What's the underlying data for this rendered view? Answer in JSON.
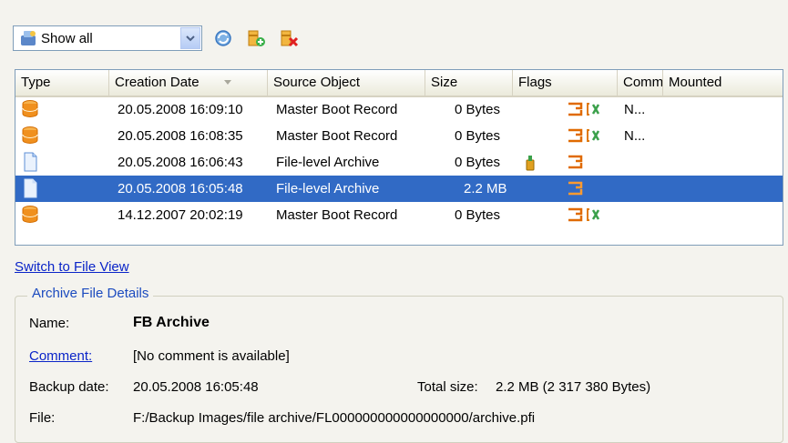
{
  "toolbar": {
    "filter_value": "Show all",
    "icons": [
      "show-all-icon",
      "refresh-icon",
      "add-archive-icon",
      "delete-archive-icon"
    ]
  },
  "grid": {
    "columns": [
      "Type",
      "Creation Date",
      "Source Object",
      "Size",
      "Flags",
      "Comm",
      "Mounted"
    ],
    "rows": [
      {
        "type_icon": "disk-archive-icon",
        "date": "20.05.2008 16:09:10",
        "source": "Master Boot Record",
        "size": "0 Bytes",
        "comment": "N...",
        "selected": false
      },
      {
        "type_icon": "disk-archive-icon",
        "date": "20.05.2008 16:08:35",
        "source": "Master Boot Record",
        "size": "0 Bytes",
        "comment": "N...",
        "selected": false
      },
      {
        "type_icon": "file-archive-icon",
        "date": "20.05.2008 16:06:43",
        "source": "File-level Archive",
        "size": "0 Bytes",
        "comment": "",
        "selected": false
      },
      {
        "type_icon": "file-archive-icon",
        "date": "20.05.2008 16:05:48",
        "source": "File-level Archive",
        "size": "2.2 MB",
        "comment": "",
        "selected": true
      },
      {
        "type_icon": "disk-archive-icon",
        "date": "14.12.2007 20:02:19",
        "source": "Master Boot Record",
        "size": "0 Bytes",
        "comment": "",
        "selected": false
      }
    ]
  },
  "switch_view_link": "Switch to File View",
  "details": {
    "group_title": "Archive File Details",
    "name_label": "Name:",
    "name_value": "FB Archive",
    "comment_label": "Comment:",
    "comment_value": "[No comment is available]",
    "backup_date_label": "Backup date:",
    "backup_date_value": "20.05.2008 16:05:48",
    "total_size_label": "Total size:",
    "total_size_value": "2.2 MB (2 317 380 Bytes)",
    "file_label": "File:",
    "file_value": "F:/Backup Images/file archive/FL000000000000000000/archive.pfi"
  },
  "colors": {
    "selection": "#316ac5",
    "link": "#0a24c8",
    "group_title": "#1c4bbf",
    "disk_icon": "#f0901e"
  }
}
